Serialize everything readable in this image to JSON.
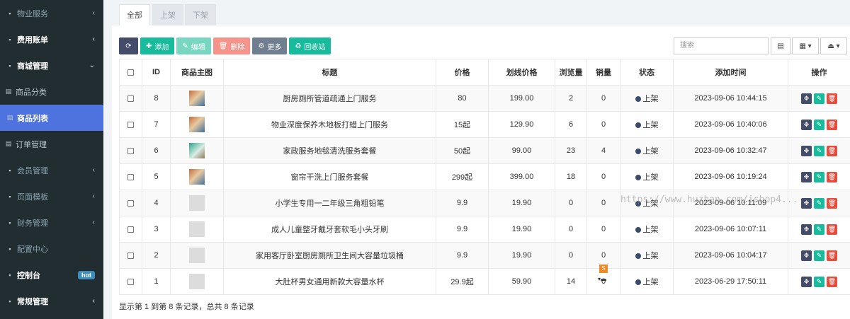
{
  "sidebar": {
    "items": [
      {
        "label": "物业服务",
        "style": "dim",
        "chevron": "‹"
      },
      {
        "label": "费用账单",
        "style": "bold",
        "chevron": "‹"
      },
      {
        "label": "商城管理",
        "style": "bold",
        "chevron": "⌄"
      },
      {
        "label": "商品分类",
        "style": "sub",
        "chevron": ""
      },
      {
        "label": "商品列表",
        "style": "active",
        "chevron": ""
      },
      {
        "label": "订单管理",
        "style": "sub",
        "chevron": ""
      },
      {
        "label": "会员管理",
        "style": "dim",
        "chevron": "‹"
      },
      {
        "label": "页面模板",
        "style": "dim",
        "chevron": "‹"
      },
      {
        "label": "财务管理",
        "style": "dim",
        "chevron": "‹"
      },
      {
        "label": "配置中心",
        "style": "dim",
        "chevron": ""
      },
      {
        "label": "控制台",
        "style": "bold",
        "chevron": "",
        "badge": "hot"
      },
      {
        "label": "常规管理",
        "style": "bold",
        "chevron": "‹"
      }
    ]
  },
  "tabs": [
    {
      "label": "全部",
      "active": true
    },
    {
      "label": "上架",
      "active": false
    },
    {
      "label": "下架",
      "active": false
    }
  ],
  "toolbar": {
    "add": "添加",
    "edit": "编辑",
    "delete": "删除",
    "more": "更多",
    "recycle": "回收站",
    "search_placeholder": "搜索"
  },
  "table": {
    "headers": [
      "ID",
      "商品主图",
      "标题",
      "价格",
      "划线价格",
      "浏览量",
      "销量",
      "状态",
      "添加时间",
      "操作"
    ],
    "rows": [
      {
        "id": "8",
        "thumb": "img",
        "title": "厨房厕所管道疏通上门服务",
        "price": "80",
        "orig": "199.00",
        "views": "2",
        "sales": "0",
        "status": "上架",
        "time": "2023-09-06 10:44:15"
      },
      {
        "id": "7",
        "thumb": "img",
        "title": "物业深度保养木地板打蜡上门服务",
        "price": "15起",
        "orig": "129.90",
        "views": "6",
        "sales": "0",
        "status": "上架",
        "time": "2023-09-06 10:40:06"
      },
      {
        "id": "6",
        "thumb": "img2",
        "title": "家政服务地毯清洗服务套餐",
        "price": "50起",
        "orig": "99.00",
        "views": "23",
        "sales": "4",
        "status": "上架",
        "time": "2023-09-06 10:32:47"
      },
      {
        "id": "5",
        "thumb": "img",
        "title": "窗帘干洗上门服务套餐",
        "price": "299起",
        "orig": "399.00",
        "views": "18",
        "sales": "0",
        "status": "上架",
        "time": "2023-09-06 10:19:24"
      },
      {
        "id": "4",
        "thumb": "plain",
        "title": "小学生专用一二年级三角粗铅笔",
        "price": "9.9",
        "orig": "19.90",
        "views": "0",
        "sales": "0",
        "status": "上架",
        "time": "2023-09-06 10:11:09"
      },
      {
        "id": "3",
        "thumb": "plain",
        "title": "成人儿童整牙戴牙套软毛小头牙刷",
        "price": "9.9",
        "orig": "19.90",
        "views": "0",
        "sales": "0",
        "status": "上架",
        "time": "2023-09-06 10:07:11"
      },
      {
        "id": "2",
        "thumb": "plain",
        "title": "家用客厅卧室厨房厕所卫生间大容量垃圾桶",
        "price": "9.9",
        "orig": "19.90",
        "views": "0",
        "sales": "0",
        "status": "上架",
        "time": "2023-09-06 10:04:17"
      },
      {
        "id": "1",
        "thumb": "plain",
        "title": "大肚杯男女通用新款大容量水杯",
        "price": "29.9起",
        "orig": "59.90",
        "views": "14",
        "sales": "0",
        "status": "上架",
        "time": "2023-06-29 17:50:11"
      }
    ]
  },
  "footer": {
    "info": "显示第 1 到第 8 条记录，总共 8 条记录"
  },
  "watermark": "https://www.huzhan.com/ishop4..."
}
